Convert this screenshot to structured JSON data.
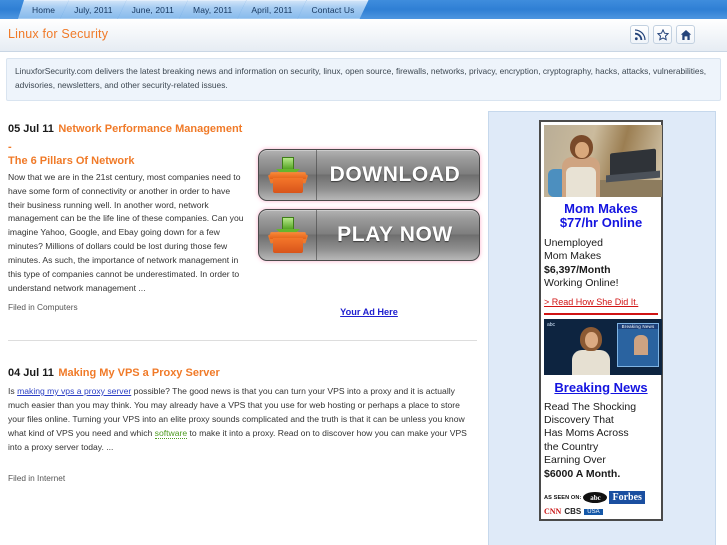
{
  "browser": {
    "tabs": [
      {
        "label": "Home"
      },
      {
        "label": "July, 2011"
      },
      {
        "label": "June, 2011"
      },
      {
        "label": "May, 2011"
      },
      {
        "label": "April, 2011"
      },
      {
        "label": "Contact Us"
      }
    ]
  },
  "header": {
    "site_title": "Linux for Security",
    "icons": [
      {
        "name": "rss-icon",
        "glyph": "rss"
      },
      {
        "name": "star-icon",
        "glyph": "star"
      },
      {
        "name": "home-icon",
        "glyph": "home"
      }
    ],
    "accent_color": "#f07a28",
    "tabbar_color": "#3f8ddd"
  },
  "description": {
    "text": "LinuxforSecurity.com delivers the latest breaking news and information on security, linux, open source, firewalls, networks, privacy, encryption, cryptography, hacks, attacks, vulnerabilities, advisories, newsletters, and other security-related issues."
  },
  "articles": [
    {
      "date": "05 Jul 11",
      "title_line1": "Network Performance Management -",
      "title_line2": "The 6 Pillars Of Network",
      "body": "Now that we are in the 21st century, most companies need to have some form of connectivity or another in order to have their business running well. In another word, network management can be the life line of these companies. Can you imagine Yahoo, Google, and Ebay going down for a few minutes? Millions of dollars could be lost during those few minutes. As such, the importance of network management in this type of companies cannot be underestimated. In order to understand network management ...",
      "filed": "Filed in Computers"
    },
    {
      "date": "04 Jul 11",
      "title_line1": "Making My VPS a Proxy Server",
      "body_part1": "Is ",
      "body_link1": "making my vps a proxy server",
      "body_part2": " possible? The good news is that you can turn your VPS into a proxy and it is actually much easier than you may think. You may already have a VPS that you use for web hosting or perhaps a place to store your files online. Turning your VPS into an elite proxy sounds complicated and the truth is that it can be unless you know what kind of VPS you need and which ",
      "body_link2": "software",
      "body_part3": " to make it into a proxy. Read on to discover how you can make your VPS into a proxy server today. ...",
      "filed": "Filed in Internet"
    }
  ],
  "ads": {
    "download_button": "DOWNLOAD",
    "play_button": "PLAY NOW",
    "your_ad_here": "Your Ad Here"
  },
  "sidebar": {
    "ad": {
      "headline_line1": "Mom Makes",
      "headline_line2": "$77/hr Online",
      "text_line1": "Unemployed",
      "text_line2": "Mom Makes",
      "text_line3": "$6,397/Month",
      "text_line4": "Working Online!",
      "cta": "> Read How She Did It.",
      "headline2": "Breaking News",
      "body_line1": "Read The Shocking",
      "body_line2": "Discovery That",
      "body_line3": "Has Moms Across",
      "body_line4": "the Country",
      "body_line5": "Earning Over",
      "body_line6": "$6000 A Month.",
      "as_seen_label": "AS SEEN ON:",
      "logo_abc": "abc",
      "logo_forbes": "Forbes",
      "logo_cnn": "CNN",
      "logo_cbs": "CBS",
      "logo_usa": "USA",
      "inset_label": "Breaking News",
      "network_logo": "abc"
    }
  }
}
